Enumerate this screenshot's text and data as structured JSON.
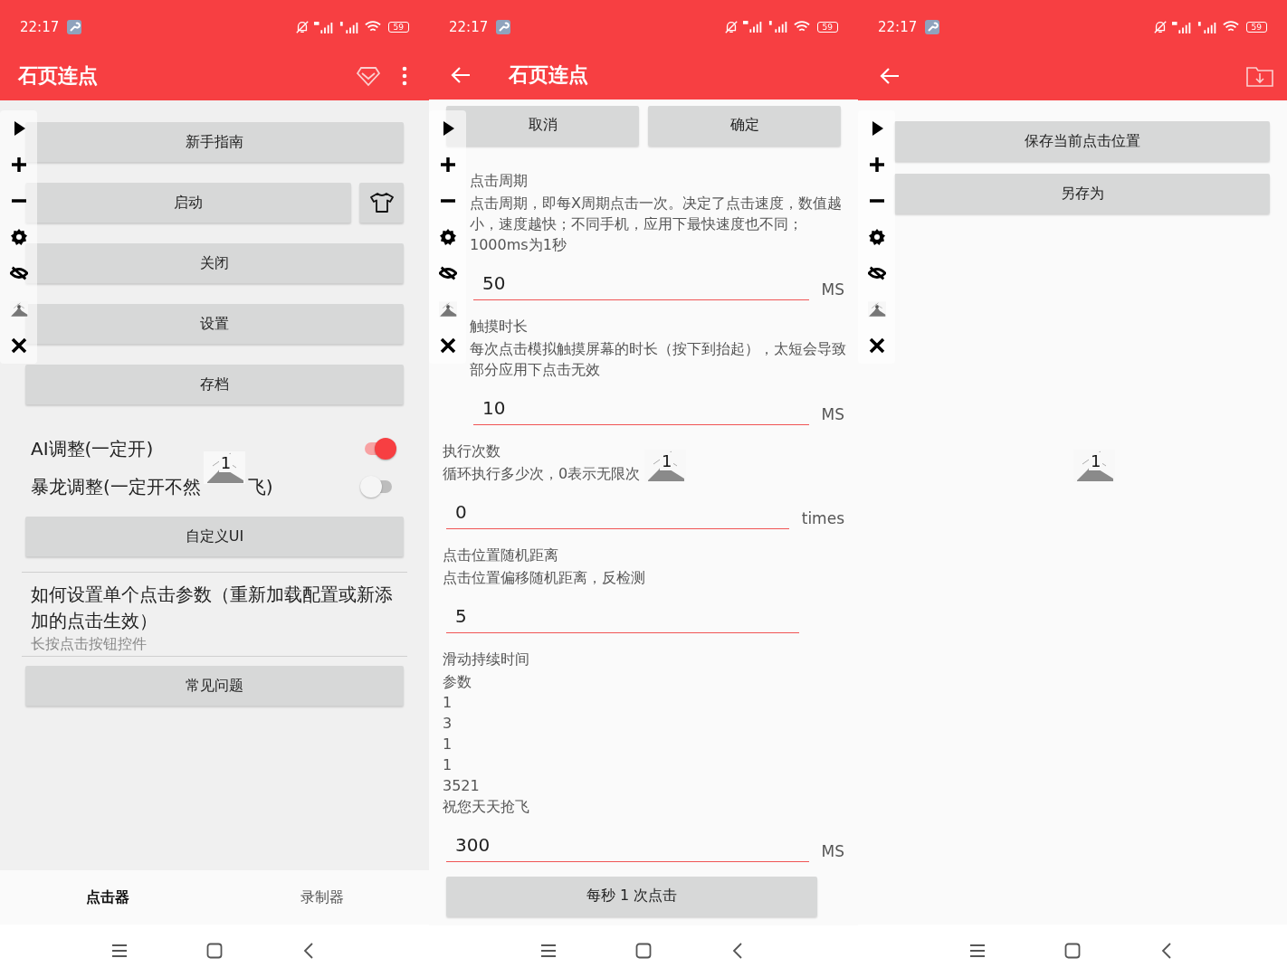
{
  "screen_main": {
    "status_bar": {
      "time": "22:17",
      "battery": "59"
    },
    "title": "石页连点",
    "buttons": [
      {
        "label": "新手指南",
        "kind": "wide"
      },
      {
        "label": "启动",
        "kind": "with_icon"
      },
      {
        "label": "关闭",
        "kind": "wide"
      },
      {
        "label": "设置",
        "kind": "wide"
      },
      {
        "label": "存档",
        "kind": "wide"
      }
    ],
    "toggles": [
      {
        "label": "AI调整(一定开)",
        "on": true
      },
      {
        "label": "暴龙调整(一定开不然",
        "label_tail": "飞)",
        "on": false
      }
    ],
    "custom_button": "自定义UI",
    "help": {
      "title": "如何设置单个点击参数（重新加载配置或新添加的点击生效）",
      "subtitle": "长按点击按钮控件"
    },
    "faq_button": "常见问题",
    "marker": "1",
    "tabs": [
      {
        "label": "点击器",
        "selected": true
      },
      {
        "label": "录制器",
        "selected": false
      }
    ]
  },
  "screen_settings": {
    "status_bar": {
      "time": "22:17",
      "battery": "59"
    },
    "title": "石页连点",
    "cancel": "取消",
    "confirm": "确定",
    "fields": [
      {
        "title": "点击周期",
        "description": [
          "点击周期，即每X周期点击一次。决定了点击速度，数值越小，速度越快；不同手机，应用下最快速度也不同；1000ms为1秒"
        ],
        "value": "50",
        "unit": "MS"
      },
      {
        "title": "触摸时长",
        "description": [
          "每次点击模拟触摸屏幕的时长（按下到抬起），太短会导致部分应用下点击无效"
        ],
        "value": "10",
        "unit": "MS"
      },
      {
        "title": "执行次数",
        "description": [
          "循环执行多少次，0表示无限次"
        ],
        "value": "0",
        "unit": "times"
      },
      {
        "title": "点击位置随机距离",
        "description": [
          "点击位置偏移随机距离，反检测"
        ],
        "value": "5"
      },
      {
        "title": "滑动持续时间",
        "description": [
          "参数",
          "1",
          "3",
          "1",
          "1",
          "3521",
          "祝您天天抢飞"
        ],
        "value": "300",
        "unit": "MS"
      }
    ],
    "marker": "1",
    "bottom_button": "每秒 1 次点击"
  },
  "screen_save": {
    "status_bar": {
      "time": "22:17",
      "battery": "59"
    },
    "buttons": [
      "保存当前点击位置",
      "另存为"
    ],
    "marker": "1"
  }
}
